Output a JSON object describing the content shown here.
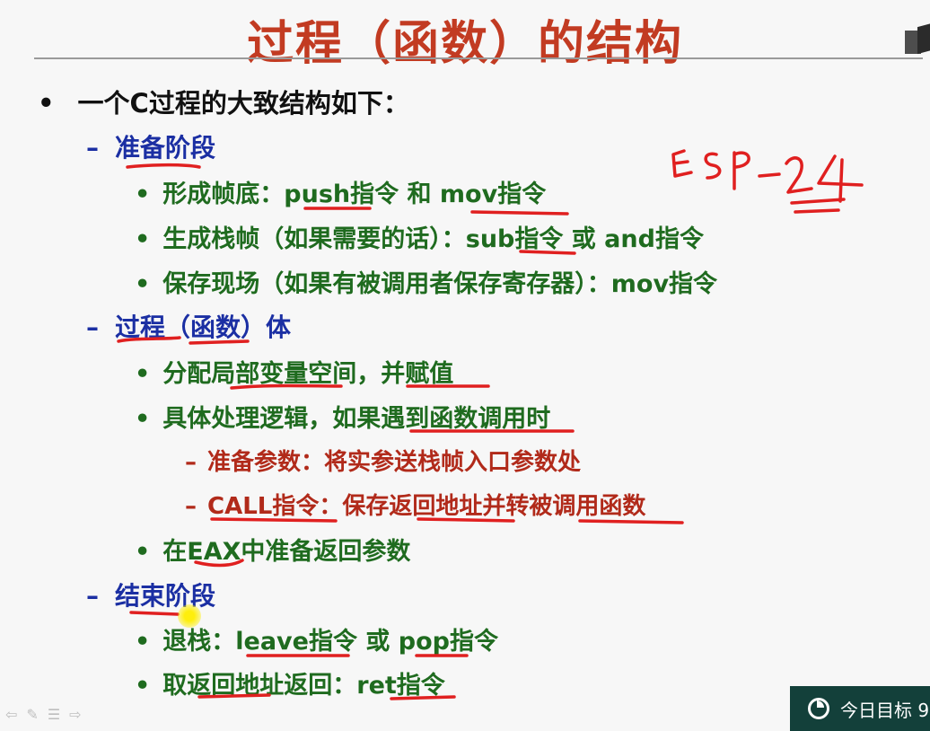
{
  "slide": {
    "title": "过程（函数）的结构",
    "lines": [
      {
        "level": 1,
        "marker": "•",
        "text": "一个C过程的大致结构如下："
      },
      {
        "level": 2,
        "marker": "–",
        "text": "准备阶段"
      },
      {
        "level": 3,
        "marker": "•",
        "text": "形成帧底：push指令 和 mov指令"
      },
      {
        "level": 3,
        "marker": "•",
        "text": "生成栈帧（如果需要的话）：sub指令 或 and指令"
      },
      {
        "level": 3,
        "marker": "•",
        "text": "保存现场（如果有被调用者保存寄存器）：mov指令"
      },
      {
        "level": 2,
        "marker": "–",
        "text": "过程（函数）体"
      },
      {
        "level": 3,
        "marker": "•",
        "text": "分配局部变量空间，并赋值"
      },
      {
        "level": 3,
        "marker": "•",
        "text": "具体处理逻辑，如果遇到函数调用时"
      },
      {
        "level": 4,
        "marker": "–",
        "text": "准备参数：将实参送栈帧入口参数处"
      },
      {
        "level": 4,
        "marker": "–",
        "text": "CALL指令：保存返回地址并转被调用函数"
      },
      {
        "level": 3,
        "marker": "•",
        "text": "在EAX中准备返回参数"
      },
      {
        "level": 2,
        "marker": "–",
        "text": "结束阶段"
      },
      {
        "level": 3,
        "marker": "•",
        "text": "退栈：leave指令 或 pop指令"
      },
      {
        "level": 3,
        "marker": "•",
        "text": "取返回地址返回：ret指令"
      }
    ]
  },
  "handwriting": {
    "text": "ESP-24",
    "color": "#e02020"
  },
  "goal_badge": {
    "label": "今日目标 9",
    "icon": "progress-circle-icon"
  },
  "toolbar": {
    "icons": [
      "prev-arrow-icon",
      "pen-icon",
      "menu-icon",
      "next-arrow-icon"
    ]
  }
}
